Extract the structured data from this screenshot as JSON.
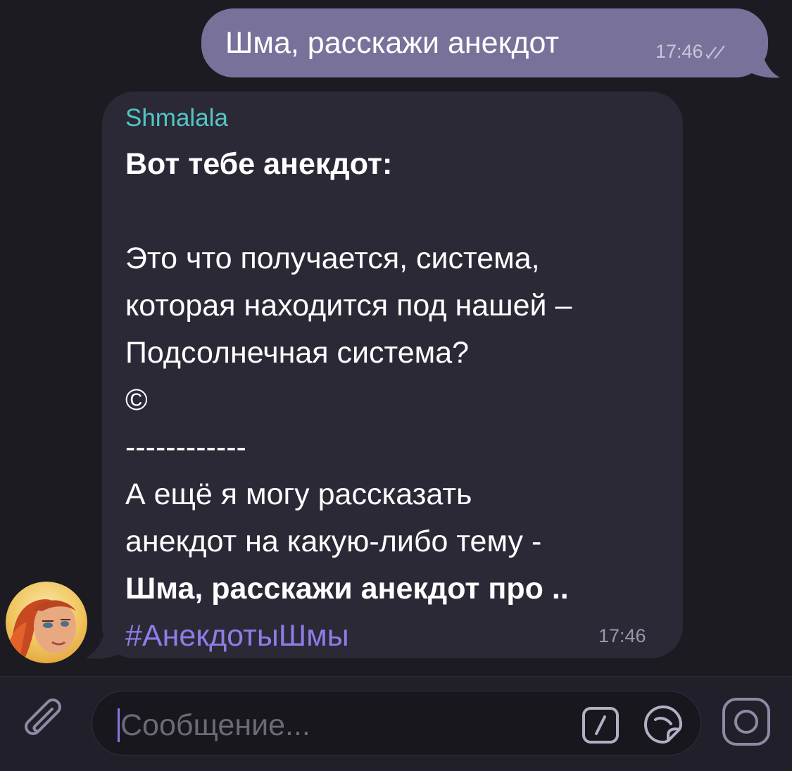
{
  "chat": {
    "outgoing": {
      "text": "Шма, расскажи анекдот",
      "time": "17:46",
      "status_icon": "double-check-icon",
      "bubble_color": "#78729a"
    },
    "incoming": {
      "sender": "Shmalala",
      "sender_color": "#52c6c5",
      "title": "Вот тебе анекдот:",
      "joke_lines": [
        "Это что получается, система,",
        "которая находится под нашей –",
        "Подсолнечная система?",
        "©",
        "------------",
        "А ещё я могу рассказать",
        "анекдот на какую-либо тему -"
      ],
      "command": "Шма, расскажи анекдот про ..",
      "hashtag": "#АнекдотыШмы",
      "hashtag_color": "#8f7ce6",
      "time": "17:46",
      "bubble_color": "#2c2937"
    }
  },
  "input_bar": {
    "placeholder": "Сообщение...",
    "attach_icon": "paperclip-icon",
    "command_icon": "slash-command-icon",
    "sticker_icon": "sticker-icon",
    "camera_icon": "camera-icon",
    "accent": "#8a78e0"
  }
}
